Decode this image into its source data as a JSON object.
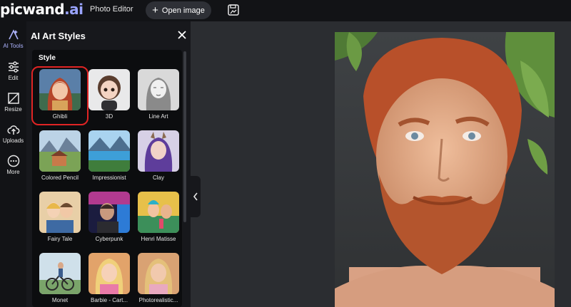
{
  "header": {
    "logo_main": "picwand",
    "logo_suffix": ".ai",
    "nav_photo_editor": "Photo Editor",
    "open_image_label": "Open image",
    "save_icon": "save-icon"
  },
  "sidebar": {
    "items": [
      {
        "label": "AI Tools",
        "icon": "ai-tools-icon"
      },
      {
        "label": "Edit",
        "icon": "sliders-icon"
      },
      {
        "label": "Resize",
        "icon": "resize-icon"
      },
      {
        "label": "Uploads",
        "icon": "upload-cloud-icon"
      },
      {
        "label": "More",
        "icon": "more-icon"
      }
    ]
  },
  "panel": {
    "title": "AI Art Styles",
    "section_label": "Style",
    "styles": [
      {
        "label": "Ghibli",
        "selected": true
      },
      {
        "label": "3D"
      },
      {
        "label": "Line Art"
      },
      {
        "label": "Colored Pencil"
      },
      {
        "label": "Impressionist"
      },
      {
        "label": "Clay"
      },
      {
        "label": "Fairy Tale"
      },
      {
        "label": "Cyberpunk"
      },
      {
        "label": "Henri Matisse"
      },
      {
        "label": "Monet"
      },
      {
        "label": "Barbie - Cart..."
      },
      {
        "label": "Photorealistic..."
      }
    ]
  },
  "colors": {
    "accent": "#9aa4ff",
    "selected_border": "#e02424",
    "topbar": "#121316",
    "canvas": "#2b2d31"
  }
}
